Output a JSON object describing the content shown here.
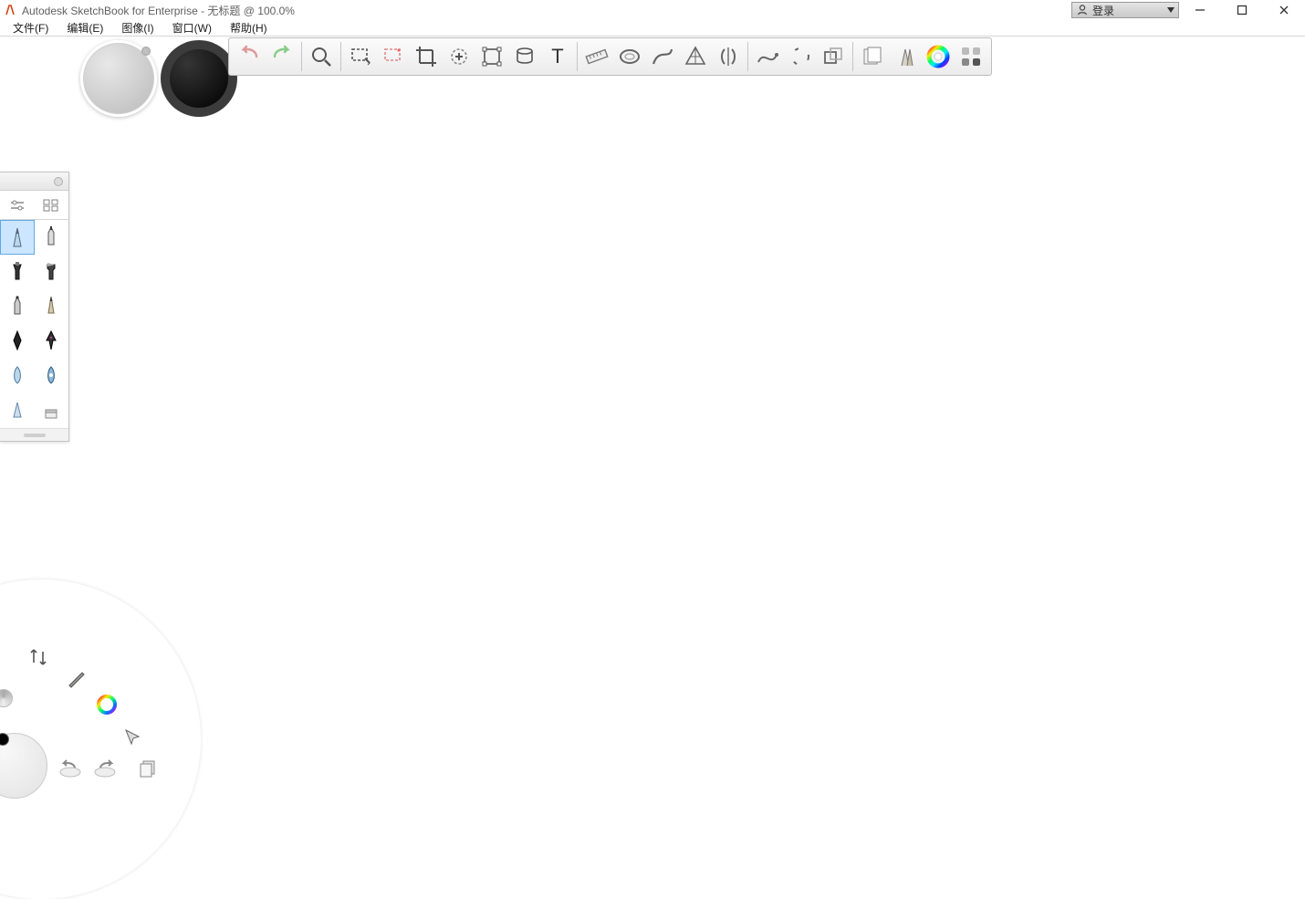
{
  "window": {
    "title": "Autodesk SketchBook for Enterprise - 无标题 @ 100.0%",
    "login_label": "登录"
  },
  "menu": {
    "file": "文件(F)",
    "edit": "编辑(E)",
    "image": "图像(I)",
    "window": "窗口(W)",
    "help": "帮助(H)"
  },
  "toolbar": {
    "tools": [
      "undo",
      "redo",
      "sep",
      "zoom",
      "sep",
      "select-rect",
      "select-magic",
      "crop",
      "add-layer",
      "transform",
      "distort",
      "text",
      "sep",
      "ruler",
      "ellipse-guide",
      "french-curve",
      "perspective",
      "symmetry",
      "sep",
      "predictive-stroke",
      "steady-stroke",
      "shape",
      "sep",
      "flipbook",
      "brushes",
      "color-wheel",
      "quad-apps"
    ]
  },
  "brush_palette": {
    "selected_index": 0,
    "brushes": [
      "pencil",
      "technical-pen",
      "marker",
      "chisel-marker",
      "ballpoint",
      "hard-pencil",
      "ink-pen",
      "nib-pen",
      "airbrush-soft",
      "airbrush-hard",
      "eraser-soft",
      "eraser-hard"
    ]
  },
  "lagoon": {
    "items": [
      "tools",
      "brush",
      "color",
      "cursor",
      "undo",
      "redo",
      "layers"
    ]
  }
}
